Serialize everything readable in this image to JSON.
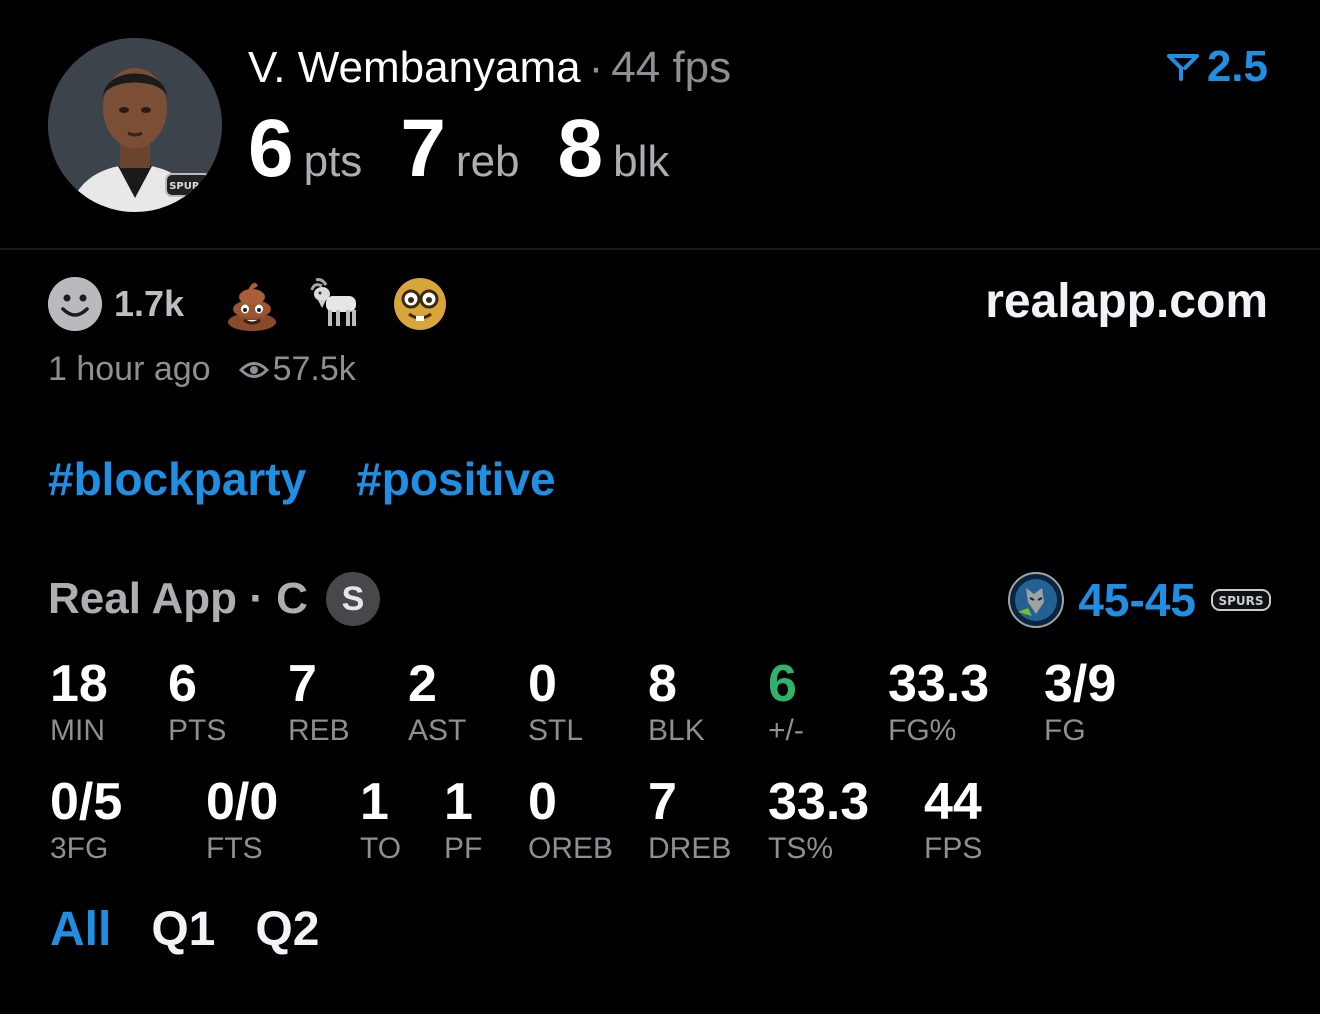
{
  "player": {
    "name": "V. Wembanyama",
    "separator": "·",
    "fps_text": "44 fps",
    "line_value": "2.5",
    "headline": [
      {
        "value": "6",
        "label": "pts"
      },
      {
        "value": "7",
        "label": "reb"
      },
      {
        "value": "8",
        "label": "blk"
      }
    ]
  },
  "post": {
    "reaction_count": "1.7k",
    "reactions": [
      "smiley-icon",
      "poop-emoji",
      "goat-emoji",
      "nerd-emoji"
    ],
    "site": "realapp.com",
    "time": "1 hour ago",
    "views": "57.5k",
    "tags": [
      "#blockparty",
      "#positive"
    ]
  },
  "game": {
    "label": "Real App · C",
    "position_badge": "S",
    "score": "45-45"
  },
  "stats_row1": [
    {
      "value": "18",
      "label": "MIN"
    },
    {
      "value": "6",
      "label": "PTS"
    },
    {
      "value": "7",
      "label": "REB"
    },
    {
      "value": "2",
      "label": "AST"
    },
    {
      "value": "0",
      "label": "STL"
    },
    {
      "value": "8",
      "label": "BLK"
    },
    {
      "value": "6",
      "label": "+/-"
    },
    {
      "value": "33.3",
      "label": "FG%"
    },
    {
      "value": "3/9",
      "label": "FG"
    }
  ],
  "stats_row2": [
    {
      "value": "0/5",
      "label": "3FG"
    },
    {
      "value": "0/0",
      "label": "FTS"
    },
    {
      "value": "1",
      "label": "TO"
    },
    {
      "value": "1",
      "label": "PF"
    },
    {
      "value": "0",
      "label": "OREB"
    },
    {
      "value": "7",
      "label": "DREB"
    },
    {
      "value": "33.3",
      "label": "TS%"
    },
    {
      "value": "44",
      "label": "FPS"
    }
  ],
  "periods": [
    "All",
    "Q1",
    "Q2"
  ],
  "colors": {
    "accent": "#1e8fe3",
    "positive": "#2fb36a",
    "muted": "#8e8e93"
  }
}
